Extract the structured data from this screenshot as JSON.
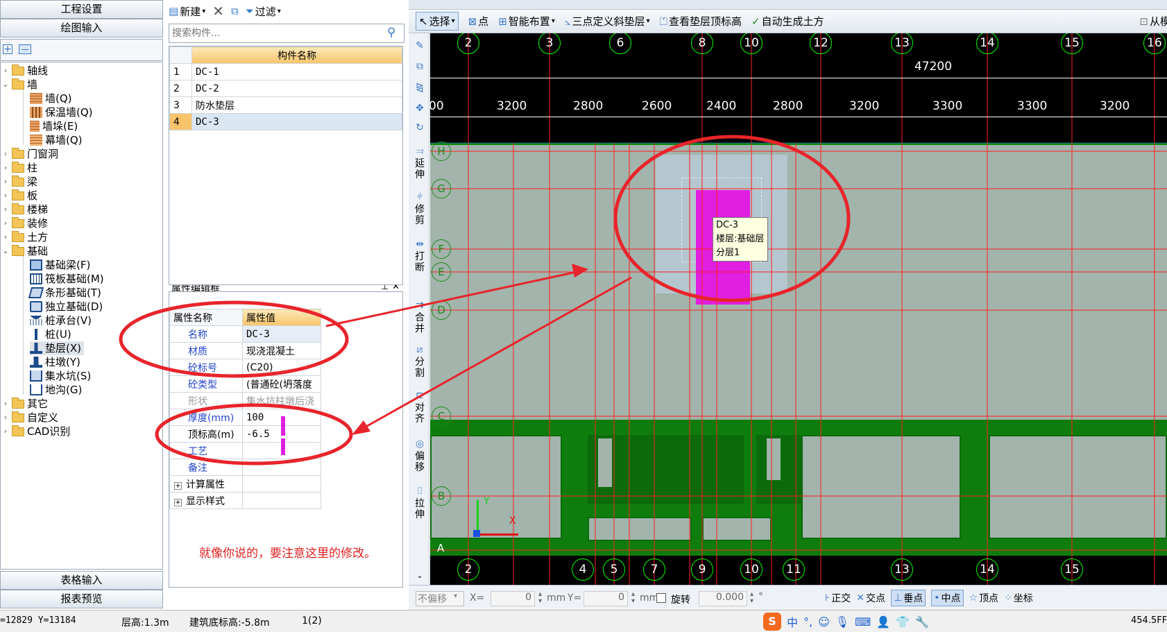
{
  "left_panel": {
    "btn_project_settings": "工程设置",
    "btn_drawing_input": "绘图输入",
    "btn_table_input": "表格输入",
    "btn_report_preview": "报表预览",
    "tree": [
      {
        "label": "轴线"
      },
      {
        "label": "墙"
      },
      {
        "label": "墙(Q)"
      },
      {
        "label": "保温墙(Q)"
      },
      {
        "label": "墙垛(E)"
      },
      {
        "label": "幕墙(Q)"
      },
      {
        "label": "门窗洞"
      },
      {
        "label": "柱"
      },
      {
        "label": "梁"
      },
      {
        "label": "板"
      },
      {
        "label": "楼梯"
      },
      {
        "label": "装修"
      },
      {
        "label": "土方"
      },
      {
        "label": "基础"
      },
      {
        "label": "基础梁(F)"
      },
      {
        "label": "筏板基础(M)"
      },
      {
        "label": "条形基础(T)"
      },
      {
        "label": "独立基础(D)"
      },
      {
        "label": "桩承台(V)"
      },
      {
        "label": "桩(U)"
      },
      {
        "label": "垫层(X)"
      },
      {
        "label": "柱墩(Y)"
      },
      {
        "label": "集水坑(S)"
      },
      {
        "label": "地沟(G)"
      },
      {
        "label": "其它"
      },
      {
        "label": "自定义"
      },
      {
        "label": "CAD识别"
      }
    ]
  },
  "component_list": {
    "new_label": "新建",
    "filter_label": "过滤",
    "search_placeholder": "搜索构件...",
    "header": "构件名称",
    "rows": [
      {
        "num": "1",
        "name": "DC-1"
      },
      {
        "num": "2",
        "name": "DC-2"
      },
      {
        "num": "3",
        "name": "防水垫层"
      },
      {
        "num": "4",
        "name": "DC-3"
      }
    ]
  },
  "props": {
    "title": "属性编辑框",
    "col_name": "属性名称",
    "col_value": "属性值",
    "rows": [
      {
        "name": "名称",
        "value": "DC-3"
      },
      {
        "name": "材质",
        "value": "现浇混凝土"
      },
      {
        "name": "砼标号",
        "value": "(C20)"
      },
      {
        "name": "砼类型",
        "value": "(普通砼(坍落度"
      },
      {
        "name": "形状",
        "value": "集水坑柱墩后浇"
      },
      {
        "name": "厚度(mm)",
        "value": "100"
      },
      {
        "name": "顶标高(m)",
        "value": "-6.5"
      },
      {
        "name": "工艺",
        "value": ""
      },
      {
        "name": "备注",
        "value": ""
      },
      {
        "name": "计算属性",
        "value": ""
      },
      {
        "name": "显示样式",
        "value": ""
      }
    ],
    "annotation": "就像你说的，要注意这里的修改。"
  },
  "toolbar": {
    "select": "选择",
    "point": "点",
    "smart_layout": "智能布置",
    "three_point": "三点定义斜垫层",
    "view_top_elev": "查看垫层顶标高",
    "auto_earth": "自动生成土方",
    "from_layer": "从模型"
  },
  "side_tools": [
    "延伸",
    "修剪",
    "打断",
    "合并",
    "分割",
    "对齐",
    "偏移",
    "拉伸"
  ],
  "canvas": {
    "total_dim": "47200",
    "top_axes": [
      "2",
      "3",
      "6",
      "8",
      "10",
      "12",
      "13",
      "14",
      "15",
      "16"
    ],
    "dims": [
      "00",
      "3200",
      "2800",
      "2600",
      "2400",
      "2800",
      "3200",
      "3300",
      "3300",
      "3200"
    ],
    "bottom_axes": [
      "2",
      "4",
      "5",
      "7",
      "9",
      "10",
      "11",
      "13",
      "14",
      "15"
    ],
    "left_axes": [
      "H",
      "G",
      "F",
      "E",
      "D",
      "C",
      "B",
      "A"
    ],
    "tooltip": {
      "line1": "DC-3",
      "line2": "楼层:基础层",
      "line3": "分层1"
    },
    "axis_y": "Y",
    "axis_x": "X"
  },
  "bottom_bar": {
    "offset_mode": "不偏移",
    "x_label": "X=",
    "x_value": "0",
    "unit1": "mm",
    "y_label": "Y=",
    "y_value": "0",
    "unit2": "mm",
    "rotate_label": "旋转",
    "rotate_value": "0.000",
    "deg": "°",
    "snap": [
      "正交",
      "交点",
      "垂点",
      "中点",
      "顶点",
      "坐标"
    ]
  },
  "status": {
    "coords": "=12829 Y=13184",
    "floor_height": "层高:1.3m",
    "base_elev": "建筑底标高:-5.8m",
    "page": "1(2)",
    "right_value": "454.5FF",
    "ime": "中"
  }
}
